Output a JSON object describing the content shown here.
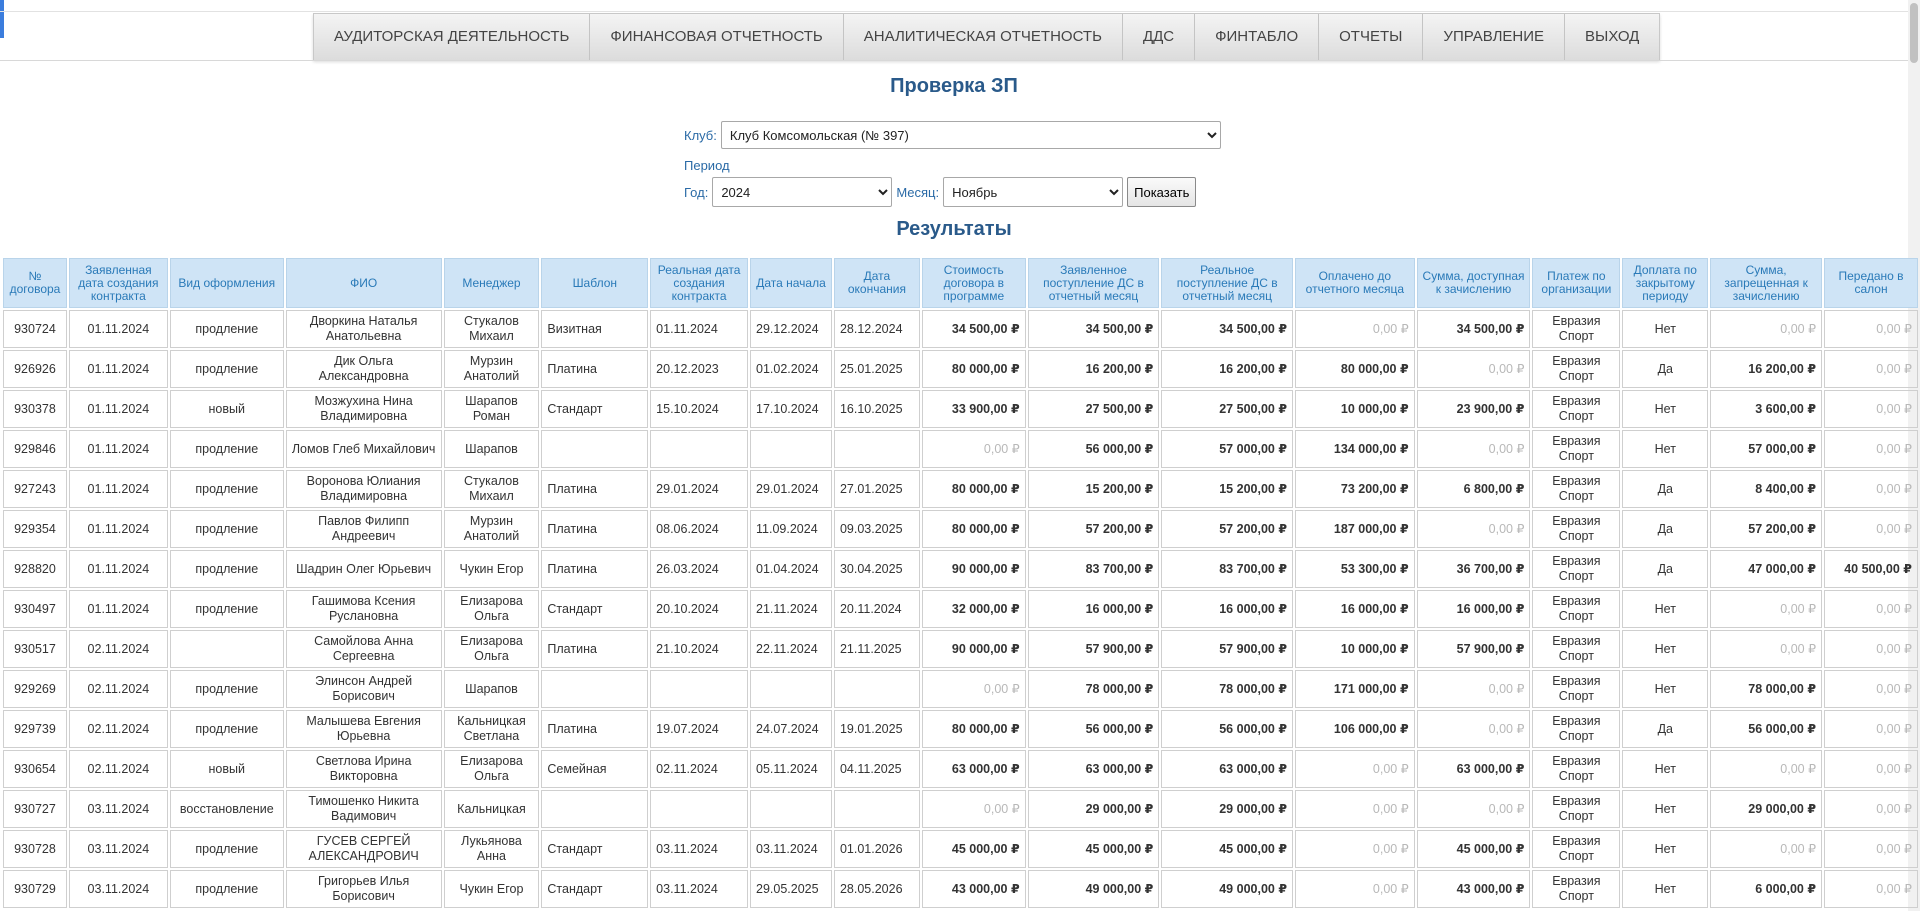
{
  "nav": {
    "items": [
      "АУДИТОРСКАЯ ДЕЯТЕЛЬНОСТЬ",
      "ФИНАНСОВАЯ ОТЧЕТНОСТЬ",
      "АНАЛИТИЧЕСКАЯ ОТЧЕТНОСТЬ",
      "ДДС",
      "ФИНТАБЛО",
      "ОТЧЕТЫ",
      "УПРАВЛЕНИЕ",
      "ВЫХОД"
    ]
  },
  "page_title": "Проверка ЗП",
  "form": {
    "club_label": "Клуб:",
    "club_value": "Клуб Комсомольская (№ 397)",
    "period_label": "Период",
    "year_label": "Год:",
    "year_value": "2024",
    "month_label": "Месяц:",
    "month_value": "Ноябрь",
    "show_button": "Показать"
  },
  "results_title": "Результаты",
  "table": {
    "columns": [
      "№ договора",
      "Заявленная дата создания контракта",
      "Вид оформления",
      "ФИО",
      "Менеджер",
      "Шаблон",
      "Реальная дата создания контракта",
      "Дата начала",
      "Дата окончания",
      "Стоимость договора в программе",
      "Заявленное поступление ДС в отчетный месяц",
      "Реальное поступление ДС в отчетный месяц",
      "Оплачено до отчетного месяца",
      "Сумма, доступная к зачислению",
      "Платеж по организации",
      "Доплата по закрытому периоду",
      "Сумма, запрещенная к зачислению",
      "Передано в салон"
    ],
    "rows": [
      [
        "930724",
        "01.11.2024",
        "продление",
        "Дворкина Наталья Анатольевна",
        "Стукалов Михаил",
        "Визитная",
        "01.11.2024",
        "29.12.2024",
        "28.12.2024",
        "34 500,00 ₽",
        "34 500,00 ₽",
        "34 500,00 ₽",
        "0,00 ₽",
        "34 500,00 ₽",
        "Евразия Спорт",
        "Нет",
        "0,00 ₽",
        "0,00 ₽"
      ],
      [
        "926926",
        "01.11.2024",
        "продление",
        "Дик Ольга Александровна",
        "Мурзин Анатолий",
        "Платина",
        "20.12.2023",
        "01.02.2024",
        "25.01.2025",
        "80 000,00 ₽",
        "16 200,00 ₽",
        "16 200,00 ₽",
        "80 000,00 ₽",
        "0,00 ₽",
        "Евразия Спорт",
        "Да",
        "16 200,00 ₽",
        "0,00 ₽"
      ],
      [
        "930378",
        "01.11.2024",
        "новый",
        "Мозжухина Нина Владимировна",
        "Шарапов Роман",
        "Стандарт",
        "15.10.2024",
        "17.10.2024",
        "16.10.2025",
        "33 900,00 ₽",
        "27 500,00 ₽",
        "27 500,00 ₽",
        "10 000,00 ₽",
        "23 900,00 ₽",
        "Евразия Спорт",
        "Нет",
        "3 600,00 ₽",
        "0,00 ₽"
      ],
      [
        "929846",
        "01.11.2024",
        "продление",
        "Ломов Глеб Михайлович",
        "Шарапов",
        "",
        "",
        "",
        "",
        "0,00 ₽",
        "56 000,00 ₽",
        "57 000,00 ₽",
        "134 000,00 ₽",
        "0,00 ₽",
        "Евразия Спорт",
        "Нет",
        "57 000,00 ₽",
        "0,00 ₽"
      ],
      [
        "927243",
        "01.11.2024",
        "продление",
        "Воронова Юлиания Владимировна",
        "Стукалов Михаил",
        "Платина",
        "29.01.2024",
        "29.01.2024",
        "27.01.2025",
        "80 000,00 ₽",
        "15 200,00 ₽",
        "15 200,00 ₽",
        "73 200,00 ₽",
        "6 800,00 ₽",
        "Евразия Спорт",
        "Да",
        "8 400,00 ₽",
        "0,00 ₽"
      ],
      [
        "929354",
        "01.11.2024",
        "продление",
        "Павлов Филипп Андреевич",
        "Мурзин Анатолий",
        "Платина",
        "08.06.2024",
        "11.09.2024",
        "09.03.2025",
        "80 000,00 ₽",
        "57 200,00 ₽",
        "57 200,00 ₽",
        "187 000,00 ₽",
        "0,00 ₽",
        "Евразия Спорт",
        "Да",
        "57 200,00 ₽",
        "0,00 ₽"
      ],
      [
        "928820",
        "01.11.2024",
        "продление",
        "Шадрин Олег Юрьевич",
        "Чукин Егор",
        "Платина",
        "26.03.2024",
        "01.04.2024",
        "30.04.2025",
        "90 000,00 ₽",
        "83 700,00 ₽",
        "83 700,00 ₽",
        "53 300,00 ₽",
        "36 700,00 ₽",
        "Евразия Спорт",
        "Да",
        "47 000,00 ₽",
        "40 500,00 ₽"
      ],
      [
        "930497",
        "01.11.2024",
        "продление",
        "Гашимова Ксения Руслановна",
        "Елизарова Ольга",
        "Стандарт",
        "20.10.2024",
        "21.11.2024",
        "20.11.2024",
        "32 000,00 ₽",
        "16 000,00 ₽",
        "16 000,00 ₽",
        "16 000,00 ₽",
        "16 000,00 ₽",
        "Евразия Спорт",
        "Нет",
        "0,00 ₽",
        "0,00 ₽"
      ],
      [
        "930517",
        "02.11.2024",
        "",
        "Самойлова Анна Сергеевна",
        "Елизарова Ольга",
        "Платина",
        "21.10.2024",
        "22.11.2024",
        "21.11.2025",
        "90 000,00 ₽",
        "57 900,00 ₽",
        "57 900,00 ₽",
        "10 000,00 ₽",
        "57 900,00 ₽",
        "Евразия Спорт",
        "Нет",
        "0,00 ₽",
        "0,00 ₽"
      ],
      [
        "929269",
        "02.11.2024",
        "продление",
        "Элинсон Андрей Борисович",
        "Шарапов",
        "",
        "",
        "",
        "",
        "0,00 ₽",
        "78 000,00 ₽",
        "78 000,00 ₽",
        "171 000,00 ₽",
        "0,00 ₽",
        "Евразия Спорт",
        "Нет",
        "78 000,00 ₽",
        "0,00 ₽"
      ],
      [
        "929739",
        "02.11.2024",
        "продление",
        "Малышева Евгения Юрьевна",
        "Кальницкая Светлана",
        "Платина",
        "19.07.2024",
        "24.07.2024",
        "19.01.2025",
        "80 000,00 ₽",
        "56 000,00 ₽",
        "56 000,00 ₽",
        "106 000,00 ₽",
        "0,00 ₽",
        "Евразия Спорт",
        "Да",
        "56 000,00 ₽",
        "0,00 ₽"
      ],
      [
        "930654",
        "02.11.2024",
        "новый",
        "Светлова Ирина Викторовна",
        "Елизарова Ольга",
        "Семейная",
        "02.11.2024",
        "05.11.2024",
        "04.11.2025",
        "63 000,00 ₽",
        "63 000,00 ₽",
        "63 000,00 ₽",
        "0,00 ₽",
        "63 000,00 ₽",
        "Евразия Спорт",
        "Нет",
        "0,00 ₽",
        "0,00 ₽"
      ],
      [
        "930727",
        "03.11.2024",
        "восстановление",
        "Тимошенко Никита Вадимович",
        "Кальницкая",
        "",
        "",
        "",
        "",
        "0,00 ₽",
        "29 000,00 ₽",
        "29 000,00 ₽",
        "0,00 ₽",
        "0,00 ₽",
        "Евразия Спорт",
        "Нет",
        "29 000,00 ₽",
        "0,00 ₽"
      ],
      [
        "930728",
        "03.11.2024",
        "продление",
        "ГУСЕВ СЕРГЕЙ АЛЕКСАНДРОВИЧ",
        "Лукьянова Анна",
        "Стандарт",
        "03.11.2024",
        "03.11.2024",
        "01.01.2026",
        "45 000,00 ₽",
        "45 000,00 ₽",
        "45 000,00 ₽",
        "0,00 ₽",
        "45 000,00 ₽",
        "Евразия Спорт",
        "Нет",
        "0,00 ₽",
        "0,00 ₽"
      ],
      [
        "930729",
        "03.11.2024",
        "продление",
        "Григорьев Илья Борисович",
        "Чукин Егор",
        "Стандарт",
        "03.11.2024",
        "29.05.2025",
        "28.05.2026",
        "43 000,00 ₽",
        "49 000,00 ₽",
        "49 000,00 ₽",
        "0,00 ₽",
        "43 000,00 ₽",
        "Евразия Спорт",
        "Нет",
        "6 000,00 ₽",
        "0,00 ₽"
      ]
    ]
  }
}
